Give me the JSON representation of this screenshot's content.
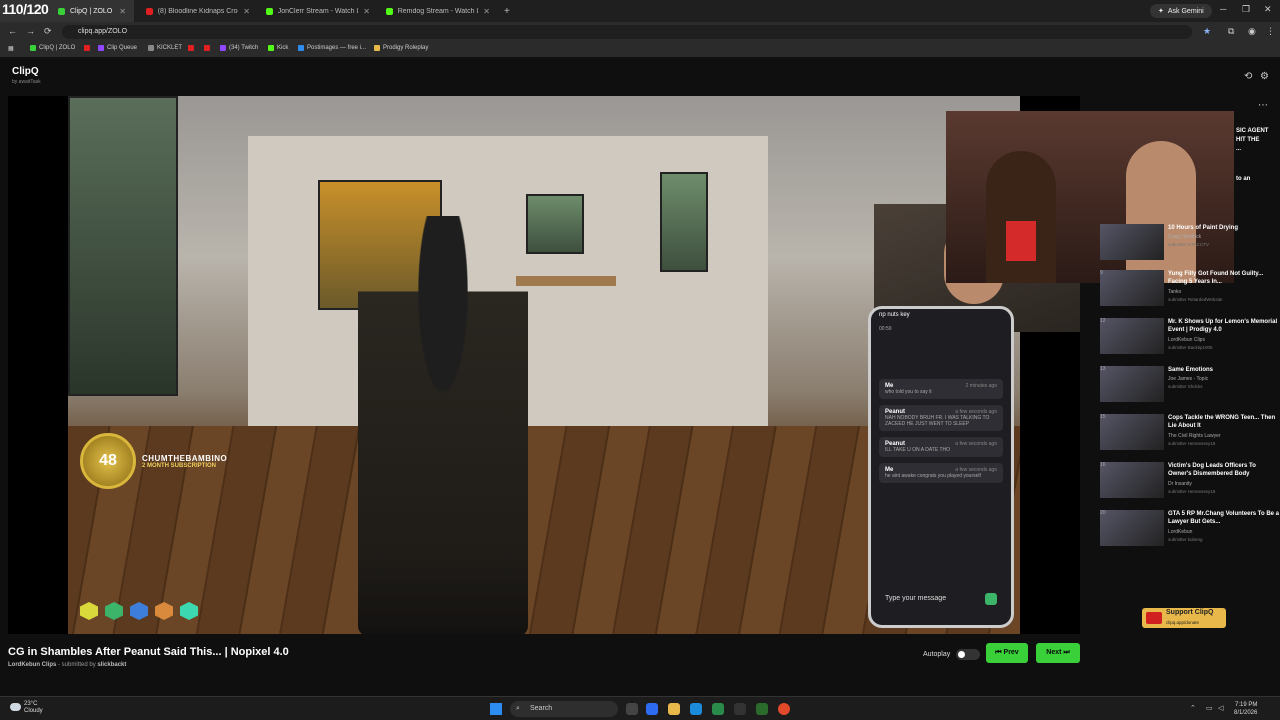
{
  "overlay_counter": "110/120",
  "tabs": [
    {
      "label": "ClipQ | ZOLO",
      "color": "#39d039"
    },
    {
      "label": "(8) Bloodline Kidnaps Croc And",
      "color": "#e02020"
    },
    {
      "label": "JonClerr Stream - Watch Live o",
      "color": "#53fc18"
    },
    {
      "label": "Remdog Stream - Watch Live o",
      "color": "#53fc18"
    }
  ],
  "new_tab": "+",
  "gemini": "Ask Gemini",
  "url": "clipq.app/ZOLO",
  "bookmarks": [
    {
      "label": "ClipQ | ZOLO",
      "color": "#39d039"
    },
    {
      "label": "",
      "color": "#e02020"
    },
    {
      "label": "Clip Queue",
      "color": "#9146ff"
    },
    {
      "label": "KICKLET",
      "color": "#888"
    },
    {
      "label": "",
      "color": "#e02020"
    },
    {
      "label": "",
      "color": "#e02020"
    },
    {
      "label": "(34) Twitch",
      "color": "#9146ff"
    },
    {
      "label": "Kick",
      "color": "#53fc18"
    },
    {
      "label": "Postimages — free i...",
      "color": "#2d8cf0"
    },
    {
      "label": "Prodigy Roleplay",
      "color": "#e8b84a"
    }
  ],
  "app": {
    "logo": "ClipQ",
    "logo_sub": "by awaitTask"
  },
  "player": {
    "sub_name": "CHUMTHEBAMBINO",
    "sub_tier": "2 MONTH SUBSCRIPTION",
    "sub_badge": "48",
    "chat_overlay_header": "dont care",
    "phone_header": "np nuts key",
    "phone_time": "00:59",
    "phone_messages": [
      {
        "from": "Me",
        "time": "2 minutes ago",
        "text": "who told you to say it"
      },
      {
        "from": "Peanut",
        "time": "a few seconds ago",
        "text": "NAH NOBODY BRUH FR. I WAS TALKING TO ZACEED HE JUST WENT TO SLEEP"
      },
      {
        "from": "Peanut",
        "time": "a few seconds ago",
        "text": "ILL TAKE U ON A DATE THO"
      },
      {
        "from": "Me",
        "time": "a few seconds ago",
        "text": "he aint awake congrats you played yourself"
      }
    ],
    "phone_input": "Type your message"
  },
  "video": {
    "title": "CG in Shambles After Peanut Said This... | Nopixel 4.0",
    "channel": "LordKebun Clips",
    "submitted_prefix": "- submitted by",
    "submitter": "slickbackt"
  },
  "controls": {
    "autoplay": "Autoplay",
    "prev": "⏮ Prev",
    "next": "Next ⏭"
  },
  "sidebar_fragments": [
    "SIC AGENT",
    "HIT THE",
    "...",
    "to an"
  ],
  "queue": [
    {
      "num": "",
      "title": "10 Hours of Paint Drying",
      "channel": "Craig Hendrick",
      "submitter": "submitter GTACCTV"
    },
    {
      "num": "9",
      "title": "Yung Filly Got Found Not Guilty... Facing 5 Years In...",
      "channel": "Tanko",
      "submitter": "submitter RetardedWebsite"
    },
    {
      "num": "12",
      "title": "Mr. K Shows Up for Lemon's Memorial Event | Prodigy 4.0",
      "channel": "LordKebun Clips",
      "submitter": "submitter Backtip1005"
    },
    {
      "num": "13",
      "title": "Same Emotions",
      "channel": "Joe James - Topic",
      "submitter": "submitter Shdcks"
    },
    {
      "num": "15",
      "title": "Cops Tackle the WRONG Teen... Then Lie About It",
      "channel": "The Civil Rights Lawyer",
      "submitter": "submitter Hennessey18"
    },
    {
      "num": "16",
      "title": "Victim's Dog Leads Officers To Owner's Dismembered Body",
      "channel": "Dr Insanity",
      "submitter": "submitter Hennessey18"
    },
    {
      "num": "20",
      "title": "GTA 5 RP Mr.Chang Volunteers To Be a Lawyer But Gets...",
      "channel": "LordKebun",
      "submitter": "submitter kobeng"
    }
  ],
  "support": {
    "label": "Support ClipQ",
    "sub": "clipq.app/donate"
  },
  "taskbar": {
    "temp": "23°C",
    "condition": "Cloudy",
    "search": "Search",
    "time": "7:19 PM",
    "date": "8/1/2026"
  }
}
